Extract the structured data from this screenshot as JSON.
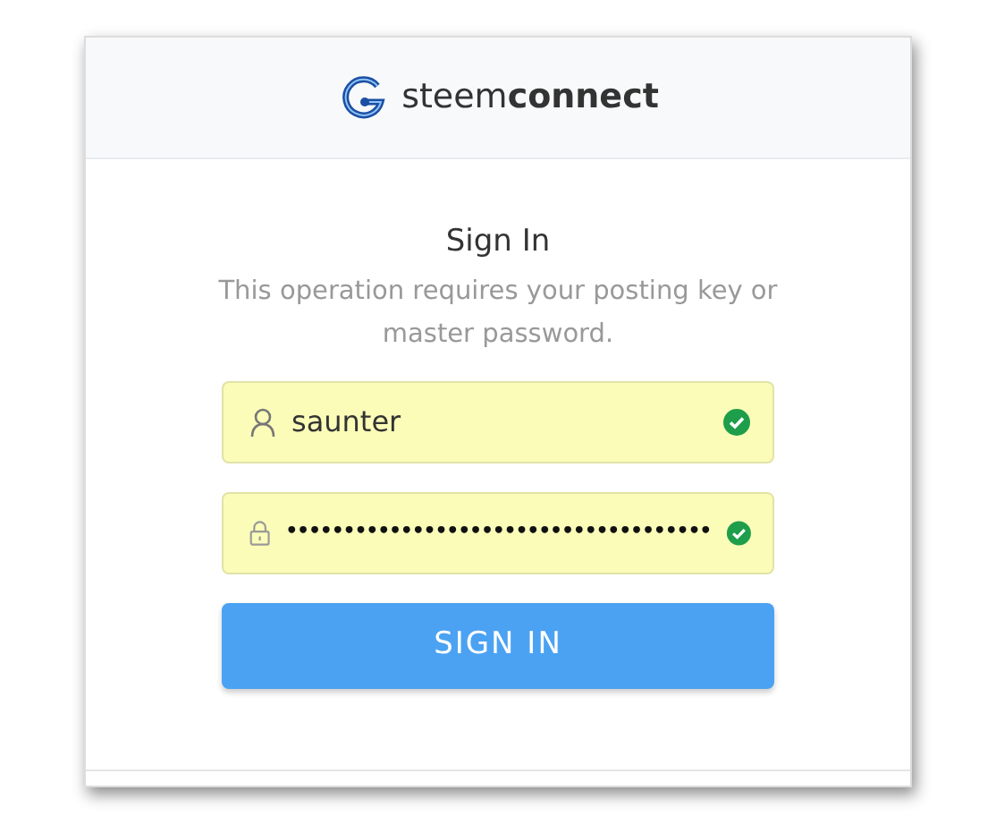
{
  "header": {
    "logo_light": "steem",
    "logo_bold": "connect"
  },
  "title": "Sign In",
  "subtitle": "This operation requires your posting key or master password.",
  "fields": [
    {
      "kind": "username",
      "value": "saunter",
      "valid": true
    },
    {
      "kind": "password",
      "value": "•••••••••••••••••••••••••••••••••••••",
      "valid": true
    }
  ],
  "button": "SIGN IN"
}
